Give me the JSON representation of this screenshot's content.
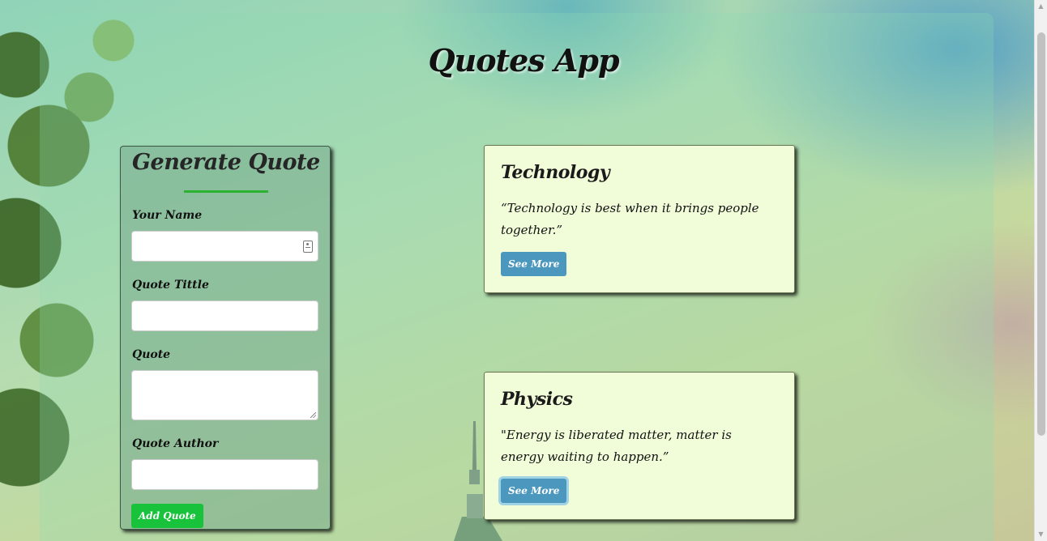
{
  "app": {
    "title": "Quotes App"
  },
  "form": {
    "heading": "Generate Quote",
    "fields": [
      {
        "label": "Your Name",
        "value": "",
        "placeholder": ""
      },
      {
        "label": "Quote Tittle",
        "value": "",
        "placeholder": ""
      },
      {
        "label": "Quote",
        "value": "",
        "placeholder": ""
      },
      {
        "label": "Quote Author",
        "value": "",
        "placeholder": ""
      }
    ],
    "submit_label": "Add Quote",
    "underline_color": "#2ab230"
  },
  "cards": [
    {
      "title": "Technology",
      "quote": "“Technology is best when it brings people together.”",
      "button_label": "See More"
    },
    {
      "title": "Physics",
      "quote": "\"Energy is liberated matter, matter is energy waiting to happen.”",
      "button_label": "See More"
    }
  ],
  "colors": {
    "card_background": "#f1fcd8",
    "see_more_button": "#4b97bd",
    "add_button": "#18c23a"
  },
  "icons": {
    "name_field": "contact-card-icon"
  }
}
